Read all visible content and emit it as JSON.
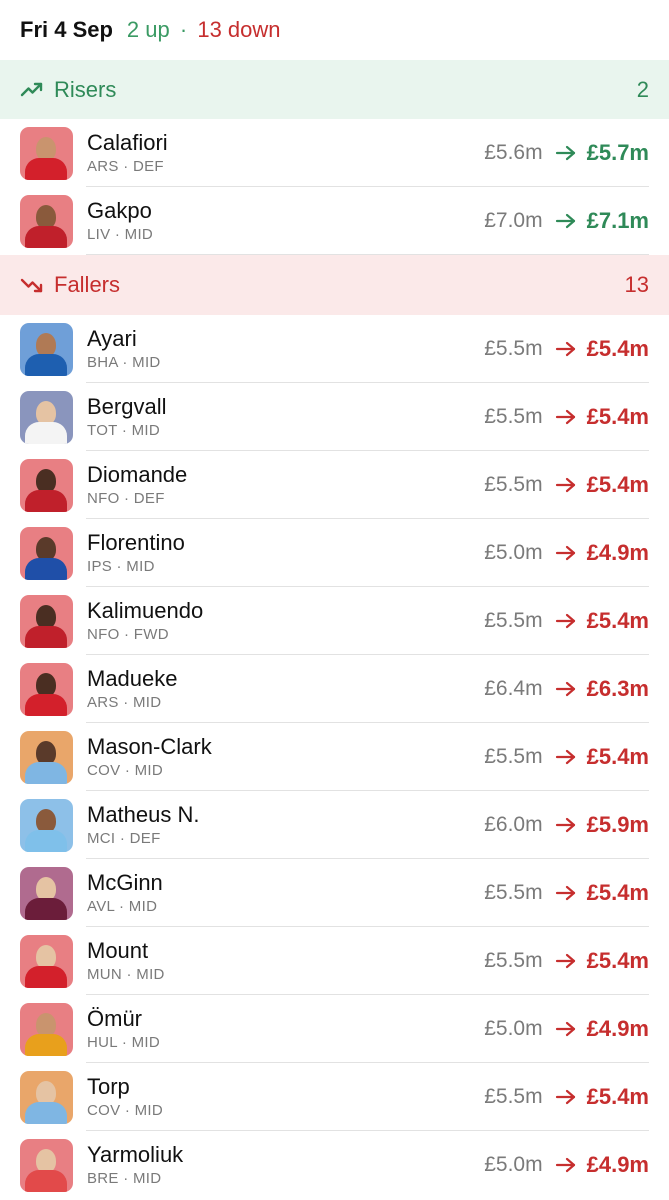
{
  "header": {
    "date": "Fri 4 Sep",
    "up_text": "2 up",
    "separator": "·",
    "down_text": "13 down"
  },
  "colors": {
    "rise": "#2f8a58",
    "fall": "#c62e2e",
    "rise_bg": "#e9f5ee",
    "fall_bg": "#fbe9e9"
  },
  "risers": {
    "title": "Risers",
    "count": "2",
    "icon": "trending-up-icon",
    "players": [
      {
        "name": "Calafiori",
        "meta": "ARS · DEF",
        "old": "£5.6m",
        "new": "£5.7m",
        "avatar_bg": "#e87f83",
        "shirt": "#d3202b",
        "skin": "#c9946e"
      },
      {
        "name": "Gakpo",
        "meta": "LIV · MID",
        "old": "£7.0m",
        "new": "£7.1m",
        "avatar_bg": "#e87f83",
        "shirt": "#c0202b",
        "skin": "#8a5a3c"
      }
    ]
  },
  "fallers": {
    "title": "Fallers",
    "count": "13",
    "icon": "trending-down-icon",
    "players": [
      {
        "name": "Ayari",
        "meta": "BHA · MID",
        "old": "£5.5m",
        "new": "£5.4m",
        "avatar_bg": "#6f9fd8",
        "shirt": "#1e5fb0",
        "skin": "#b07a55"
      },
      {
        "name": "Bergvall",
        "meta": "TOT · MID",
        "old": "£5.5m",
        "new": "£5.4m",
        "avatar_bg": "#8a95bd",
        "shirt": "#f4f4f4",
        "skin": "#e5c3a3"
      },
      {
        "name": "Diomande",
        "meta": "NFO · DEF",
        "old": "£5.5m",
        "new": "£5.4m",
        "avatar_bg": "#e87f83",
        "shirt": "#c0202b",
        "skin": "#4a2e22"
      },
      {
        "name": "Florentino",
        "meta": "IPS · MID",
        "old": "£5.0m",
        "new": "£4.9m",
        "avatar_bg": "#e87f83",
        "shirt": "#1f4fa8",
        "skin": "#5a3a2a"
      },
      {
        "name": "Kalimuendo",
        "meta": "NFO · FWD",
        "old": "£5.5m",
        "new": "£5.4m",
        "avatar_bg": "#e87f83",
        "shirt": "#c0202b",
        "skin": "#4a2e22"
      },
      {
        "name": "Madueke",
        "meta": "ARS · MID",
        "old": "£6.4m",
        "new": "£6.3m",
        "avatar_bg": "#e87f83",
        "shirt": "#d3202b",
        "skin": "#4a2e22"
      },
      {
        "name": "Mason-Clark",
        "meta": "COV · MID",
        "old": "£5.5m",
        "new": "£5.4m",
        "avatar_bg": "#e9a66a",
        "shirt": "#7fb6e3",
        "skin": "#5a3a2a"
      },
      {
        "name": "Matheus N.",
        "meta": "MCI · DEF",
        "old": "£6.0m",
        "new": "£5.9m",
        "avatar_bg": "#8dc0e8",
        "shirt": "#7fc0ea",
        "skin": "#8a5a3c"
      },
      {
        "name": "McGinn",
        "meta": "AVL · MID",
        "old": "£5.5m",
        "new": "£5.4m",
        "avatar_bg": "#b06b8f",
        "shirt": "#6b1d3a",
        "skin": "#e5c3a3"
      },
      {
        "name": "Mount",
        "meta": "MUN · MID",
        "old": "£5.5m",
        "new": "£5.4m",
        "avatar_bg": "#e87f83",
        "shirt": "#d3202b",
        "skin": "#e5c3a3"
      },
      {
        "name": "Ömür",
        "meta": "HUL · MID",
        "old": "£5.0m",
        "new": "£4.9m",
        "avatar_bg": "#e87f83",
        "shirt": "#e8a01c",
        "skin": "#c9946e"
      },
      {
        "name": "Torp",
        "meta": "COV · MID",
        "old": "£5.5m",
        "new": "£5.4m",
        "avatar_bg": "#e9a66a",
        "shirt": "#7fb6e3",
        "skin": "#e5c3a3"
      },
      {
        "name": "Yarmoliuk",
        "meta": "BRE · MID",
        "old": "£5.0m",
        "new": "£4.9m",
        "avatar_bg": "#e87f83",
        "shirt": "#e24a4a",
        "skin": "#e5c3a3"
      }
    ]
  }
}
